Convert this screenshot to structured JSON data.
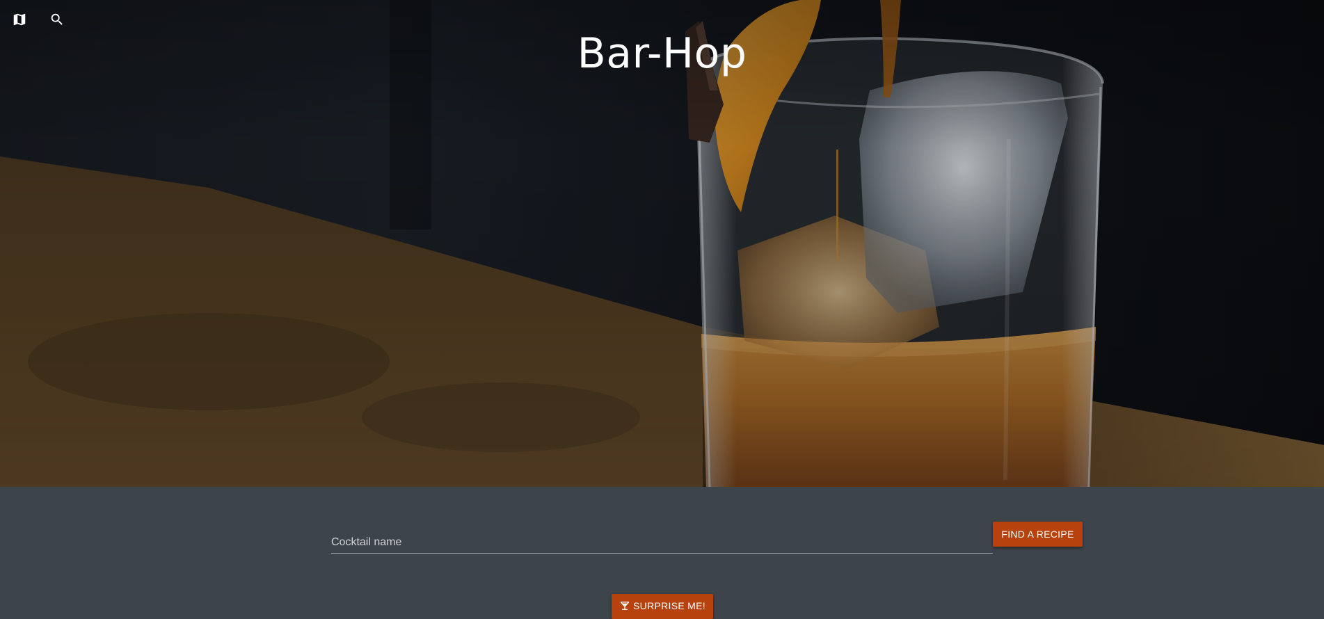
{
  "header": {
    "title": "Bar-Hop",
    "icons": [
      "map-icon",
      "search-icon"
    ]
  },
  "search": {
    "placeholder": "Cocktail name",
    "value": "",
    "find_label": "FIND A RECIPE"
  },
  "surprise": {
    "label": "SURPRISE ME!",
    "icon": "cocktail-glass-icon"
  },
  "colors": {
    "accent": "#b8420d",
    "panel": "#3d444b",
    "title": "#ffffff"
  }
}
